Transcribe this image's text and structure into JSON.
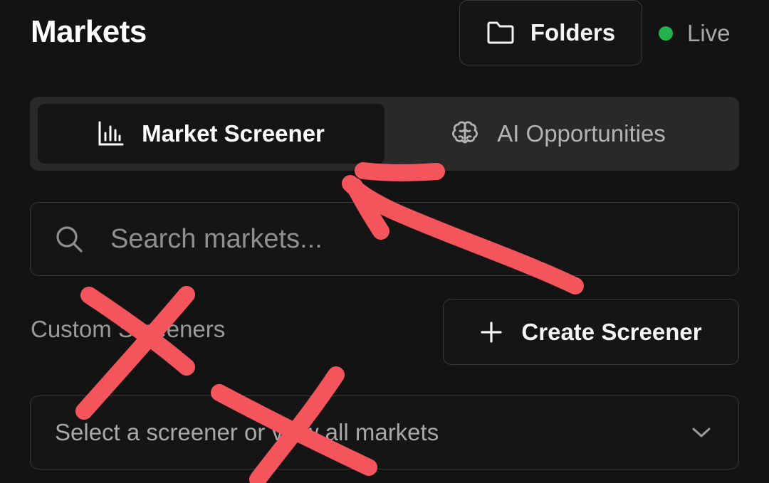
{
  "header": {
    "title": "Markets",
    "folders_label": "Folders",
    "live_label": "Live",
    "live_color": "#22b14c"
  },
  "tabs": [
    {
      "label": "Market Screener",
      "icon": "bar-chart-icon",
      "active": true
    },
    {
      "label": "AI Opportunities",
      "icon": "brain-icon",
      "active": false
    }
  ],
  "search": {
    "placeholder": "Search markets...",
    "value": "",
    "icon": "search-icon"
  },
  "custom_screeners": {
    "label": "Custom Screeners",
    "create_label": "Create Screener",
    "create_icon": "plus-icon"
  },
  "screener_select": {
    "selected": "Select a screener or view all markets",
    "icon": "chevron-down-icon"
  },
  "annotation_color": "#f4545c"
}
